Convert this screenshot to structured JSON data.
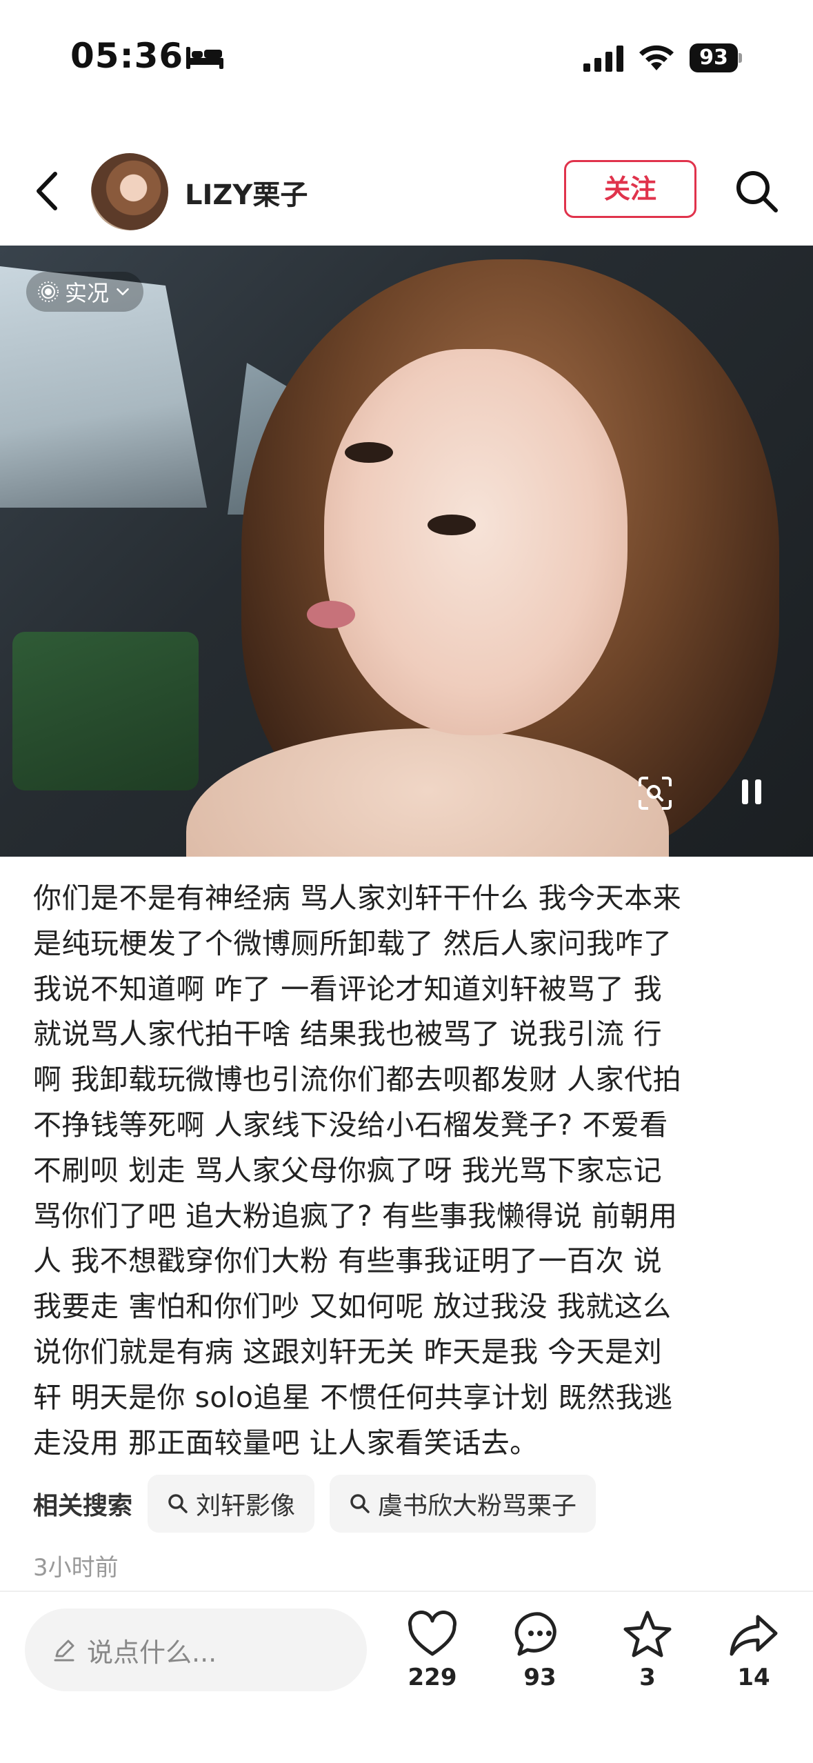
{
  "status_bar": {
    "time": "05:36",
    "battery": "93",
    "icons": [
      "bed-icon",
      "signal-icon",
      "wifi-icon",
      "battery-icon"
    ]
  },
  "header": {
    "author_name": "LIZY栗子",
    "follow_label": "关注",
    "icons": [
      "back-icon",
      "search-icon"
    ]
  },
  "photo": {
    "live_label": "实况",
    "icons": [
      "live-photo-icon",
      "chevron-down-icon",
      "scan-icon",
      "pause-icon"
    ]
  },
  "post": {
    "lines": [
      "你们是不是有神经病 骂人家刘轩干什么 我今天本来",
      "是纯玩梗发了个微博厕所卸载了 然后人家问我咋了",
      "我说不知道啊 咋了 一看评论才知道刘轩被骂了 我",
      "就说骂人家代拍干啥 结果我也被骂了 说我引流 行",
      "啊 我卸载玩微博也引流你们都去呗都发财 人家代拍",
      "不挣钱等死啊 人家线下没给小石榴发凳子? 不爱看",
      "不刷呗 划走 骂人家父母你疯了呀 我光骂下家忘记",
      "骂你们了吧 追大粉追疯了? 有些事我懒得说 前朝用",
      "人 我不想戳穿你们大粉 有些事我证明了一百次 说",
      "我要走 害怕和你们吵 又如何呢 放过我没 我就这么",
      "说你们就是有病 这跟刘轩无关 昨天是我 今天是刘",
      "轩 明天是你 solo追星 不惯任何共享计划 既然我逃",
      "走没用 那正面较量吧 让人家看笑话去。"
    ],
    "time_ago": "3小时前"
  },
  "related": {
    "label": "相关搜索",
    "chips": [
      "刘轩影像",
      "虞书欣大粉骂栗子"
    ]
  },
  "bottom_bar": {
    "comment_placeholder": "说点什么...",
    "likes": "229",
    "comments": "93",
    "stars": "3",
    "shares": "14"
  },
  "colors": {
    "accent": "#e0334c",
    "text": "#222222",
    "muted": "#999999"
  }
}
